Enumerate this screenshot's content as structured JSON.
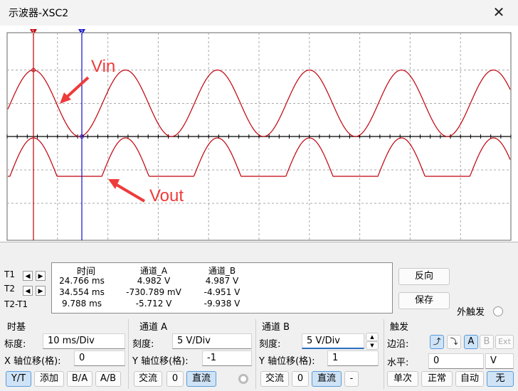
{
  "window": {
    "title": "示波器-XSC2"
  },
  "scope_labels": {
    "vin": "Vin",
    "vout": "Vout",
    "marker1": "1",
    "marker2": "2"
  },
  "colors": {
    "trace": "#c0000a",
    "cursor1": "#c0000a",
    "cursor2": "#1010c8",
    "annotation": "#ee3b3b"
  },
  "cursors": {
    "t1": "T1",
    "t2": "T2",
    "diff": "T2-T1",
    "headers": {
      "time": "时间",
      "ch_a": "通道_A",
      "ch_b": "通道_B"
    },
    "rows": [
      {
        "time": "24.766 ms",
        "a": "4.982 V",
        "b": "4.987 V"
      },
      {
        "time": "34.554 ms",
        "a": "-730.789 mV",
        "b": "-4.951 V"
      },
      {
        "time": "9.788 ms",
        "a": "-5.712 V",
        "b": "-9.938 V"
      }
    ]
  },
  "buttons": {
    "reverse": "反向",
    "save": "保存",
    "ext_trigger": "外触发"
  },
  "timebase": {
    "title": "时基",
    "scale_label": "标度:",
    "scale": "10 ms/Div",
    "xpos_label": "X 轴位移(格):",
    "xpos": "0",
    "modes": [
      "Y/T",
      "添加",
      "B/A",
      "A/B"
    ]
  },
  "channel_a": {
    "title": "通道 A",
    "scale_label": "刻度:",
    "scale": "5  V/Div",
    "ypos_label": "Y 轴位移(格):",
    "ypos": "-1",
    "coupling": [
      "交流",
      "0",
      "直流"
    ]
  },
  "channel_b": {
    "title": "通道 B",
    "scale_label": "刻度:",
    "scale": "5  V/Div",
    "ypos_label": "Y 轴位移(格):",
    "ypos": "1",
    "coupling": [
      "交流",
      "0",
      "直流",
      "-"
    ]
  },
  "trigger": {
    "title": "触发",
    "edge_label": "边沿:",
    "level_label": "水平:",
    "level": "0",
    "level_unit": "V",
    "sources": [
      "A",
      "B",
      "Ext"
    ],
    "modes": [
      "单次",
      "正常",
      "自动",
      "无"
    ]
  }
}
